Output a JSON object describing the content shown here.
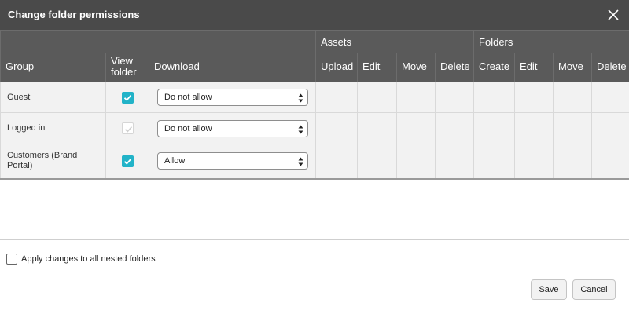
{
  "dialog": {
    "title": "Change folder permissions",
    "close_icon": "close-icon"
  },
  "table": {
    "group_headers": {
      "assets": "Assets",
      "folders": "Folders"
    },
    "columns": {
      "group": "Group",
      "view_folder_1": "View",
      "view_folder_2": "folder",
      "download": "Download",
      "assets_upload": "Upload",
      "assets_edit": "Edit",
      "assets_move": "Move",
      "assets_delete": "Delete",
      "folders_create": "Create",
      "folders_edit": "Edit",
      "folders_move": "Move",
      "folders_delete": "Delete"
    },
    "rows": [
      {
        "group": "Guest",
        "view_folder": "checked",
        "download": "Do not allow"
      },
      {
        "group": "Logged in",
        "view_folder": "checked-disabled",
        "download": "Do not allow"
      },
      {
        "group": "Customers (Brand Portal)",
        "view_folder": "checked",
        "download": "Allow"
      }
    ]
  },
  "nested": {
    "label": "Apply changes to all nested folders",
    "checked": false
  },
  "buttons": {
    "save": "Save",
    "cancel": "Cancel"
  },
  "colors": {
    "header_bg": "#4a4a4a",
    "table_header_bg": "#5a5a5a",
    "checkbox_accent": "#22b3c8",
    "row_bg": "#f2f2f2"
  }
}
